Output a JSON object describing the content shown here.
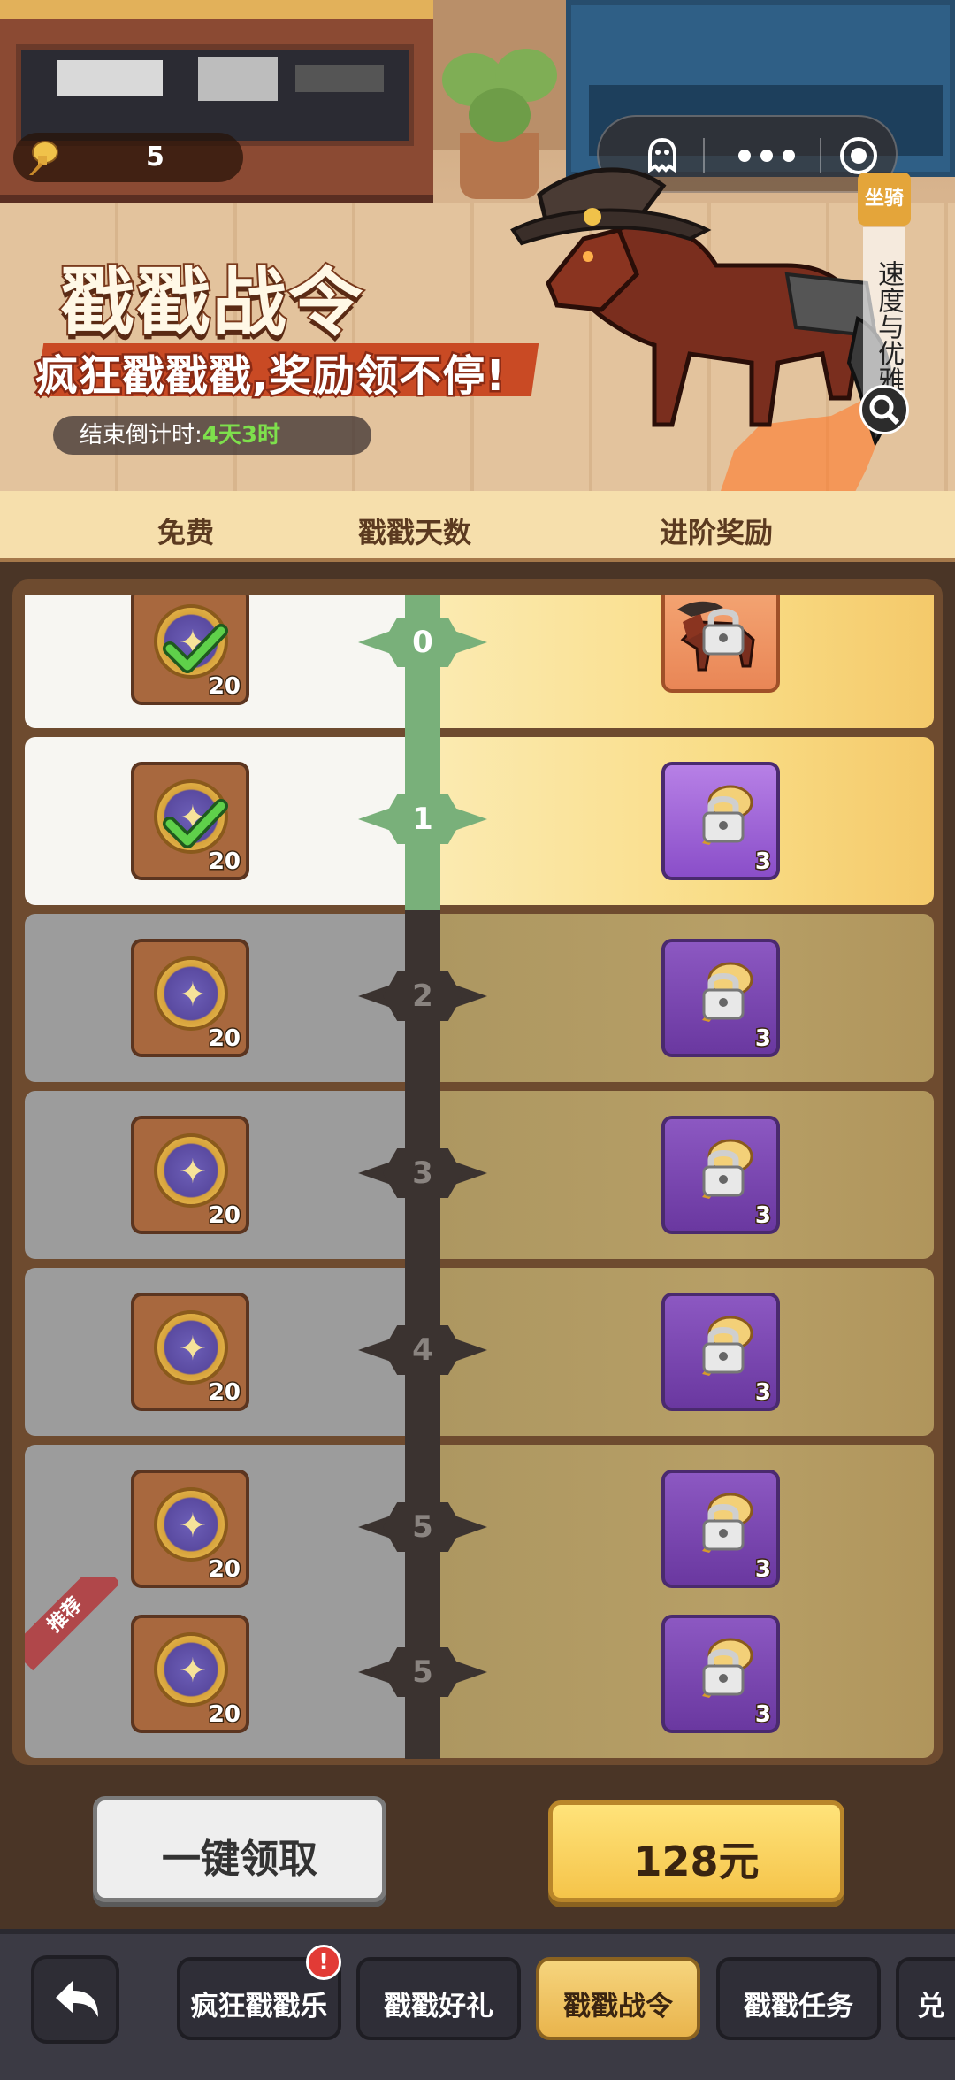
{
  "header": {
    "pin_count": "5",
    "title": "戳戳战令",
    "subtitle": "疯狂戳戳戳,奖励领不停!",
    "countdown_label": "结束倒计时:",
    "countdown_value": "4天3时",
    "mount_tag": "坐骑",
    "mount_text": "速度与优雅"
  },
  "columns": {
    "free": "免费",
    "days": "戳戳天数",
    "advanced": "进阶奖励"
  },
  "rows": [
    {
      "day": "0",
      "free_qty": "20",
      "free_claimed": true,
      "adv_item": "horse-mount",
      "adv_qty": "",
      "state": "claimed"
    },
    {
      "day": "1",
      "free_qty": "20",
      "free_claimed": true,
      "adv_item": "gold-pin",
      "adv_qty": "3",
      "state": "claimed"
    },
    {
      "day": "2",
      "free_qty": "20",
      "free_claimed": false,
      "adv_item": "gold-pin",
      "adv_qty": "3",
      "state": "locked"
    },
    {
      "day": "3",
      "free_qty": "20",
      "free_claimed": false,
      "adv_item": "gold-pin",
      "adv_qty": "3",
      "state": "locked"
    },
    {
      "day": "4",
      "free_qty": "20",
      "free_claimed": false,
      "adv_item": "gold-pin",
      "adv_qty": "3",
      "state": "locked"
    },
    {
      "day": "5",
      "free_qty": "20",
      "free_claimed": false,
      "adv_item": "gold-pin",
      "adv_qty": "3",
      "state": "locked"
    },
    {
      "day": "5",
      "free_qty": "20",
      "free_claimed": false,
      "adv_item": "gold-pin",
      "adv_qty": "3",
      "state": "locked",
      "recommended": "推荐"
    }
  ],
  "actions": {
    "claim_all": "一键领取",
    "buy_price": "128元"
  },
  "tabs": [
    {
      "label": "疯狂戳戳乐",
      "active": false,
      "alert": "!"
    },
    {
      "label": "戳戳好礼",
      "active": false
    },
    {
      "label": "戳戳战令",
      "active": true
    },
    {
      "label": "戳戳任务",
      "active": false
    },
    {
      "label": "兑",
      "active": false
    }
  ],
  "colors": {
    "progress_green": "#79b07a",
    "locked_track": "#3b3330",
    "advanced_purple": "#8a4ec9",
    "buy_yellow": "#f5c44a"
  }
}
